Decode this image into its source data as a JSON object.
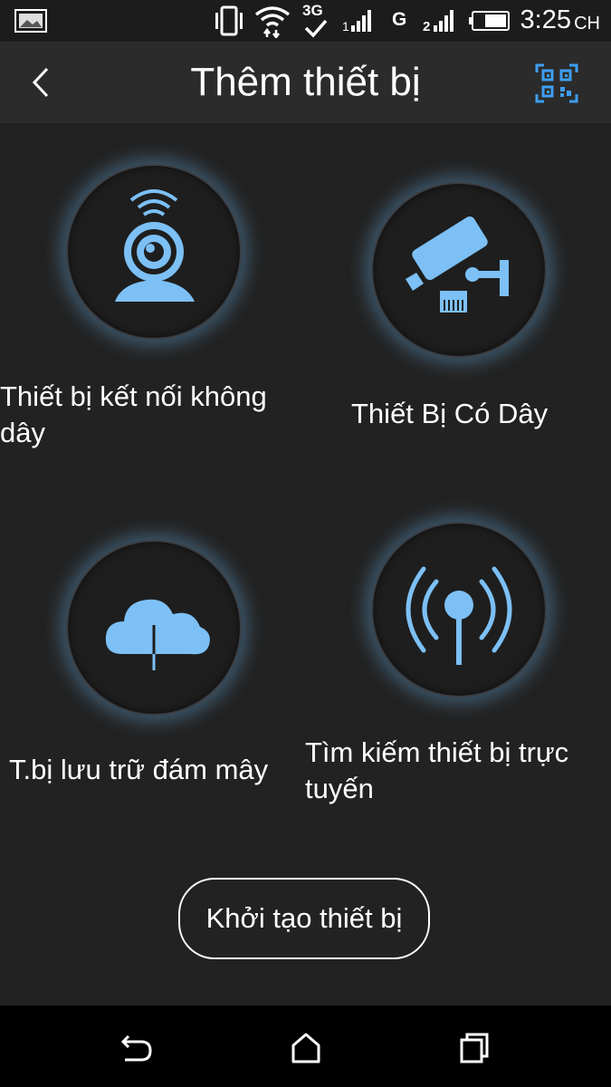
{
  "status_bar": {
    "time": "3:25",
    "ampm": "CH",
    "network_type": "3G",
    "carrier_g": "G",
    "icons": [
      "gallery-icon",
      "vibrate-icon",
      "wifi-icon",
      "3g-icon",
      "signal-icon",
      "g-icon",
      "signal2-icon",
      "battery-icon"
    ]
  },
  "header": {
    "title": "Thêm thiết bị",
    "back_icon": "chevron-left-icon",
    "qr_icon": "qr-code-icon"
  },
  "options": [
    {
      "label": "Thiết bị kết nối không dây",
      "icon": "wireless-camera-icon"
    },
    {
      "label": "Thiết Bị Có Dây",
      "icon": "wired-camera-icon"
    },
    {
      "label": "T.bị lưu trữ đám mây",
      "icon": "cloud-download-icon"
    },
    {
      "label": "Tìm kiếm thiết bị trực tuyến",
      "icon": "broadcast-icon"
    }
  ],
  "init_button": {
    "label": "Khởi tạo thiết bị"
  },
  "nav": {
    "back": "back-icon",
    "home": "home-icon",
    "recents": "recents-icon"
  },
  "colors": {
    "accent": "#6fb6f0",
    "background": "#242424",
    "header": "#2b2b2b"
  }
}
